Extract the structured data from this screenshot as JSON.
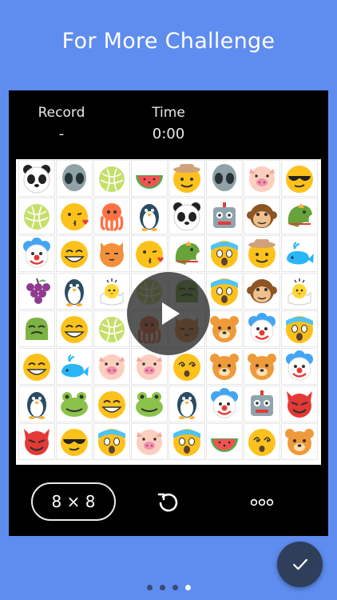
{
  "header": {
    "title": "For More Challenge"
  },
  "stats": {
    "record_label": "Record",
    "record_value": "-",
    "time_label": "Time",
    "time_value": "0:00"
  },
  "board": {
    "size_label": "8 × 8",
    "rows": [
      [
        "panda",
        "alien",
        "melon",
        "watermelon",
        "cowboy",
        "alien",
        "pig",
        "sunglasses"
      ],
      [
        "melon",
        "kiss",
        "octopus",
        "penguin",
        "panda",
        "robot",
        "monkey",
        "dragon"
      ],
      [
        "clown",
        "grin",
        "cat",
        "kiss",
        "dragon",
        "scream",
        "cowboy",
        "whale"
      ],
      [
        "grapes",
        "penguin",
        "chick",
        "melon",
        "frog-blob",
        "scream",
        "monkey",
        "chick"
      ],
      [
        "frog-blob",
        "grin",
        "melon",
        "octopus",
        "cat",
        "bear",
        "clown",
        "scream"
      ],
      [
        "grin",
        "whale",
        "pig",
        "pig",
        "dizzy",
        "bear",
        "bear",
        "clown"
      ],
      [
        "penguin",
        "frog",
        "grin",
        "frog",
        "penguin",
        "clown",
        "robot",
        "devil"
      ],
      [
        "devil",
        "sunglasses",
        "scream",
        "pig",
        "scream",
        "watermelon",
        "dizzy",
        "bear"
      ]
    ]
  },
  "pager": {
    "count": 4,
    "active_index": 3
  }
}
